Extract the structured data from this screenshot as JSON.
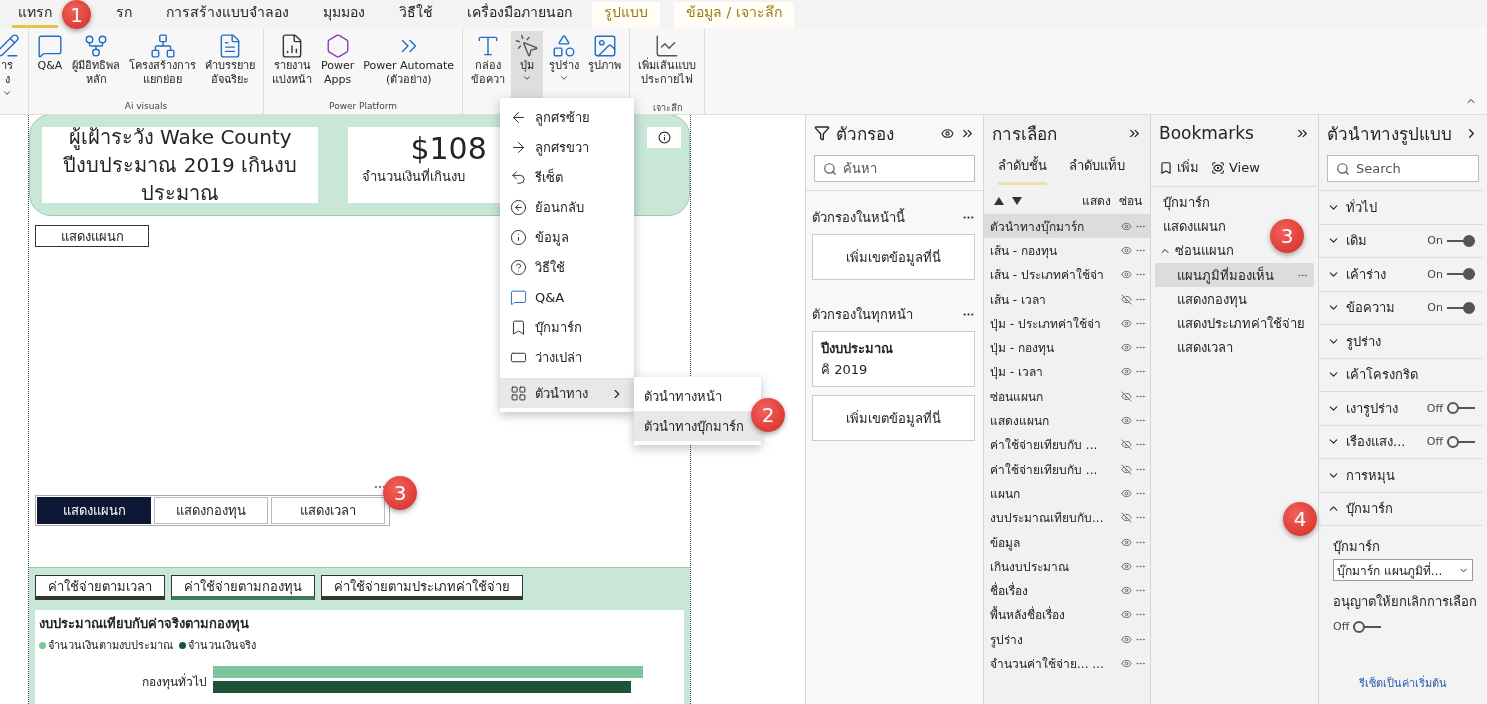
{
  "ribbon": {
    "badge": "1",
    "tabs": [
      {
        "label": "แทรก",
        "selected": true,
        "kind": "normal"
      },
      {
        "label": "รก",
        "selected": false,
        "kind": "normal"
      },
      {
        "label": "การสร้างแบบจำลอง",
        "selected": false,
        "kind": "normal"
      },
      {
        "label": "มุมมอง",
        "selected": false,
        "kind": "normal"
      },
      {
        "label": "วิธีใช้",
        "selected": false,
        "kind": "normal"
      },
      {
        "label": "เครื่องมือภายนอก",
        "selected": false,
        "kind": "normal"
      },
      {
        "label": "รูปแบบ",
        "selected": false,
        "kind": "context"
      },
      {
        "label": "ข้อมูล / เจาะลึก",
        "selected": false,
        "kind": "context"
      }
    ],
    "groups": [
      {
        "buttons": [
          {
            "lines": [
              "าร",
              "ง"
            ],
            "caret": true,
            "selected": false
          }
        ]
      },
      {
        "label": "Ai visuals",
        "buttons": [
          {
            "lines": [
              "Q&A"
            ],
            "selected": false
          },
          {
            "lines": [
              "ผู้มีอิทธิพล",
              "หลัก"
            ],
            "selected": false
          },
          {
            "lines": [
              "โครงสร้างการ",
              "แยกย่อย"
            ],
            "selected": false
          },
          {
            "lines": [
              "คำบรรยาย",
              "อัจฉริยะ"
            ],
            "selected": false
          }
        ]
      },
      {
        "label": "Power Platform",
        "buttons": [
          {
            "lines": [
              "รายงาน",
              "แบ่งหน้า"
            ],
            "selected": false
          },
          {
            "lines": [
              "Power",
              "Apps"
            ],
            "selected": false
          },
          {
            "lines": [
              "Power Automate",
              "(ตัวอย่าง)"
            ],
            "selected": false
          }
        ]
      },
      {
        "buttons": [
          {
            "lines": [
              "กล่อง",
              "ข้อควา"
            ],
            "selected": false
          },
          {
            "lines": [
              "ปุ่ม"
            ],
            "caret": true,
            "selected": true
          },
          {
            "lines": [
              "รูปร่าง"
            ],
            "caret": true,
            "selected": false
          },
          {
            "lines": [
              "รูปภาพ"
            ],
            "selected": false
          }
        ]
      },
      {
        "label": "เจาะลึก",
        "buttons": [
          {
            "lines": [
              "เพิ่มเส้นแบบ",
              "ประกายไฟ"
            ],
            "selected": false
          }
        ]
      }
    ]
  },
  "menu": {
    "badge": "2",
    "items": [
      {
        "label": "ลูกศรซ้าย",
        "kind": "item",
        "selected": false
      },
      {
        "label": "ลูกศรขวา",
        "kind": "item",
        "selected": false
      },
      {
        "label": "รีเซ็ต",
        "kind": "item",
        "selected": false
      },
      {
        "label": "ย้อนกลับ",
        "kind": "item",
        "selected": false
      },
      {
        "label": "ข้อมูล",
        "kind": "item",
        "selected": false
      },
      {
        "label": "วิธีใช้",
        "kind": "item",
        "selected": false
      },
      {
        "label": "Q&A",
        "kind": "item",
        "selected": false
      },
      {
        "label": "บุ๊กมาร์ก",
        "kind": "item",
        "selected": false
      },
      {
        "label": "ว่างเปล่า",
        "kind": "item",
        "selected": false
      },
      {
        "label": "ตัวนำทาง",
        "kind": "submenu",
        "selected": true
      }
    ],
    "submenu": [
      {
        "label": "ตัวนำทางหน้า",
        "selected": false
      },
      {
        "label": "ตัวนำทางบุ๊กมาร์ก",
        "selected": true
      }
    ]
  },
  "canvas": {
    "header": {
      "title": "ผู้เฝ้าระวัง Wake County ปีงบประมาณ 2019 เกินงบประมาณ",
      "kpi_value": "$108",
      "kpi_label": "จำนวนเงินที่เกินงบ"
    },
    "show_button": "แสดงแผนก",
    "nav_buttons": {
      "badge": "3",
      "items": [
        {
          "label": "แสดงแผนก",
          "selected": true
        },
        {
          "label": "แสดงกองทุน",
          "selected": false
        },
        {
          "label": "แสดงเวลา",
          "selected": false
        }
      ]
    },
    "tabs": [
      {
        "label": "ค่าใช้จ่ายตามเวลา",
        "selected": false
      },
      {
        "label": "ค่าใช้จ่ายตามกองทุน",
        "selected": true
      },
      {
        "label": "ค่าใช้จ่ายตามประเภทค่าใช้จ่าย",
        "selected": false
      }
    ],
    "chart": {
      "title": "งบประมาณเทียบกับค่าจริงตามกองทุน",
      "legend": [
        {
          "label": "จำนวนเงินตามงบประมาณ",
          "color": "#7cc49a"
        },
        {
          "label": "จำนวนเงินจริง",
          "color": "#1b5436"
        }
      ],
      "categories": [
        "กองทุนทั่วไป"
      ]
    }
  },
  "filters": {
    "title": "ตัวกรอง",
    "search_placeholder": "ค้นหา",
    "sections": [
      {
        "title": "ตัวกรองในหน้านี้",
        "cards": [
          {
            "kind": "drop",
            "label": "เพิ่มเขตข้อมูลที่นี่"
          }
        ]
      },
      {
        "title": "ตัวกรองในทุกหน้า",
        "cards": [
          {
            "kind": "filter",
            "field": "ปีงบประมาณ",
            "value": "คิ 2019"
          },
          {
            "kind": "drop",
            "label": "เพิ่มเขตข้อมูลที่นี่"
          }
        ]
      }
    ]
  },
  "selection": {
    "title": "การเลือก",
    "tabs": [
      {
        "label": "ลำดับชั้น",
        "selected": true
      },
      {
        "label": "ลำดับแท็บ",
        "selected": false
      }
    ],
    "show_label": "แสดง",
    "hide_label": "ซ่อน",
    "items": [
      {
        "label": "ตัวนำทางบุ๊กมาร์ก",
        "visible": true,
        "selected": true
      },
      {
        "label": "เส้น - กองทุน",
        "visible": true,
        "selected": false
      },
      {
        "label": "เส้น - ประเภทค่าใช้จ่า",
        "visible": true,
        "selected": false
      },
      {
        "label": "เส้น - เวลา",
        "visible": false,
        "selected": false
      },
      {
        "label": "ปุ่ม - ประเภทค่าใช้จ่า",
        "visible": true,
        "selected": false
      },
      {
        "label": "ปุ่ม - กองทุน",
        "visible": true,
        "selected": false
      },
      {
        "label": "ปุ่ม - เวลา",
        "visible": true,
        "selected": false
      },
      {
        "label": "ซ่อนแผนก",
        "visible": false,
        "selected": false
      },
      {
        "label": "แสดงแผนก",
        "visible": true,
        "selected": false
      },
      {
        "label": "ค่าใช้จ่ายเทียบกับ ...",
        "visible": false,
        "selected": false
      },
      {
        "label": "ค่าใช้จ่ายเทียบกับ ...",
        "visible": false,
        "selected": false
      },
      {
        "label": "แผนก",
        "visible": true,
        "selected": false
      },
      {
        "label": "งบประมาณเทียบกับ...",
        "visible": false,
        "selected": false
      },
      {
        "label": "ข้อมูล",
        "visible": true,
        "selected": false
      },
      {
        "label": "เกินงบประมาณ",
        "visible": true,
        "selected": false
      },
      {
        "label": "ชื่อเรื่อง",
        "visible": true,
        "selected": false
      },
      {
        "label": "พื้นหลังชื่อเรื่อง",
        "visible": true,
        "selected": false
      },
      {
        "label": "รูปร่าง",
        "visible": true,
        "selected": false
      },
      {
        "label": "จำนวนค่าใช้จ่าย... ...",
        "visible": true,
        "selected": false
      }
    ]
  },
  "bookmarks": {
    "title": "Bookmarks",
    "add_label": "เพิ่ม",
    "view_label": "View",
    "badge": "3",
    "items": [
      {
        "label": "บุ๊กมาร์ก",
        "selected": false
      },
      {
        "label": "แสดงแผนก",
        "selected": false
      },
      {
        "label": "ซ่อนแผนก",
        "selected": false,
        "expanded": true,
        "children": [
          {
            "label": "แผนภูมิที่มองเห็น",
            "selected": true
          },
          {
            "label": "แสดงกองทุน",
            "selected": false
          },
          {
            "label": "แสดงประเภทค่าใช้จ่าย",
            "selected": false
          },
          {
            "label": "แสดงเวลา",
            "selected": false
          }
        ]
      }
    ]
  },
  "format": {
    "title": "ตัวนำทางรูปแบบ",
    "search_placeholder": "Search",
    "badge": "4",
    "sections": [
      {
        "label": "ทั่วไป",
        "expanded": false
      },
      {
        "label": "เดิม",
        "expanded": false,
        "toggle": {
          "on": true,
          "label": "On"
        }
      },
      {
        "label": "เค้าร่าง",
        "expanded": false,
        "toggle": {
          "on": true,
          "label": "On"
        }
      },
      {
        "label": "ข้อความ",
        "expanded": false,
        "toggle": {
          "on": true,
          "label": "On"
        }
      },
      {
        "label": "รูปร่าง",
        "expanded": false
      },
      {
        "label": "เค้าโครงกริด",
        "expanded": false
      },
      {
        "label": "เงารูปร่าง",
        "expanded": false,
        "toggle": {
          "on": false,
          "label": "Off"
        }
      },
      {
        "label": "เรืองแสง...",
        "expanded": false,
        "toggle": {
          "on": false,
          "label": "Off"
        }
      },
      {
        "label": "การหมุน",
        "expanded": false
      },
      {
        "label": "บุ๊กมาร์ก",
        "expanded": true
      }
    ],
    "bookmark_field": {
      "label": "บุ๊กมาร์ก",
      "value": "บุ๊กมาร์ก แผนภูมิที่..."
    },
    "deselect": {
      "label": "อนุญาตให้ยกเลิกการเลือก",
      "toggle": {
        "on": false,
        "label": "Off"
      }
    },
    "reset_link": "รีเซ็ตเป็นค่าเริ่มต้น"
  }
}
